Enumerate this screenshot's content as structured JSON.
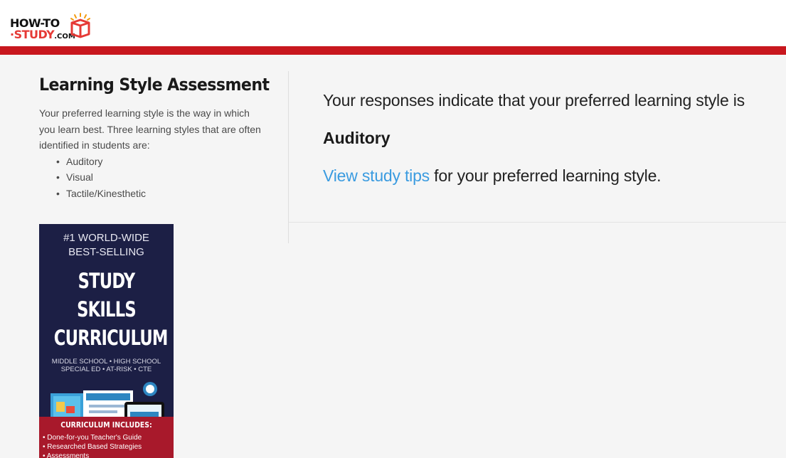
{
  "logo": {
    "line1": "HOW-TO",
    "line2_prefix": "·STUDY",
    "line2_suffix": ".COM"
  },
  "sidebar": {
    "title": "Learning Style Assessment",
    "intro": "Your preferred learning style is the way in which you learn best. Three learning styles that are often identified in students are:",
    "styles": [
      "Auditory",
      "Visual",
      "Tactile/Kinesthetic"
    ]
  },
  "result": {
    "intro": "Your responses indicate that your preferred learning style is",
    "style": "Auditory",
    "tips_link": "View study tips",
    "tips_suffix": " for your preferred learning style."
  },
  "ad": {
    "top_line1": "#1 WORLD-WIDE",
    "top_line2": "BEST-SELLING",
    "title_line1": "STUDY SKILLS",
    "title_line2": "CURRICULUM",
    "sub_line1": "MIDDLE SCHOOL • HIGH SCHOOL",
    "sub_line2": "SPECIAL ED • AT-RISK • CTE",
    "includes": "CURRICULUM INCLUDES:",
    "items": [
      "Done-for-you Teacher's Guide",
      "Researched Based Strategies",
      "Assessments"
    ]
  },
  "colors": {
    "brand_red": "#c8171e",
    "link_blue": "#3a9be0",
    "ad_navy": "#1c1f45",
    "ad_red": "#a8192b"
  }
}
